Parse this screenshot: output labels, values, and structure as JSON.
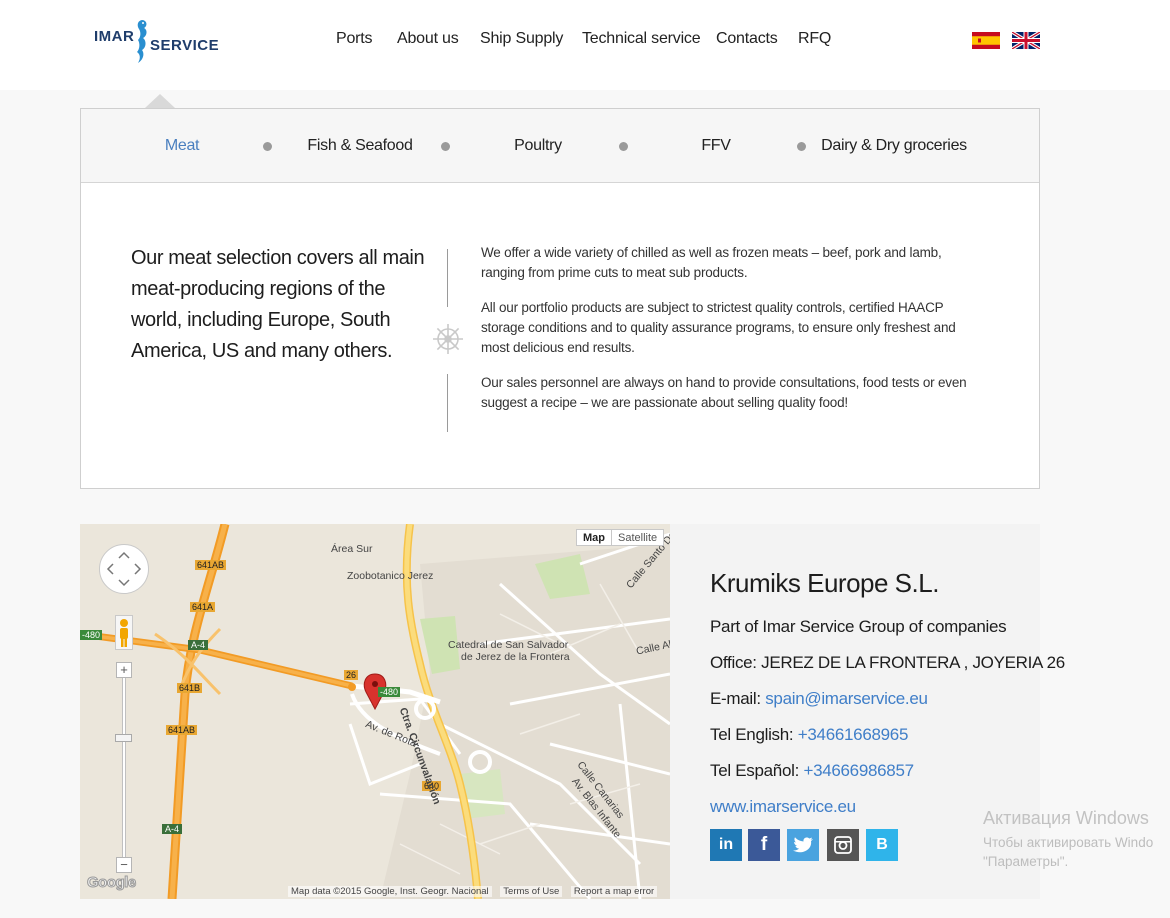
{
  "header": {
    "logo_left": "IMAR",
    "logo_right": "SERVICE",
    "nav": [
      {
        "label": "Ports"
      },
      {
        "label": "About us"
      },
      {
        "label": "Ship Supply"
      },
      {
        "label": "Technical service"
      },
      {
        "label": "Contacts"
      },
      {
        "label": "RFQ"
      }
    ]
  },
  "categories": {
    "tabs": [
      {
        "label": "Meat",
        "active": true
      },
      {
        "label": "Fish & Seafood",
        "active": false
      },
      {
        "label": "Poultry",
        "active": false
      },
      {
        "label": "FFV",
        "active": false
      },
      {
        "label": "Dairy & Dry groceries",
        "active": false
      }
    ],
    "lead": "Our meat selection covers all main meat-producing regions of the world, including Europe, South America, US and many others.",
    "paragraphs": [
      "We offer a wide variety of chilled as well as frozen meats – beef, pork and lamb, ranging from prime cuts to meat sub products.",
      "All our portfolio products are subject to strictest quality controls, certified HAACP storage conditions and to quality assurance programs, to ensure only freshest and most delicious end results.",
      "Our sales personnel are always on hand to provide consultations, food tests or even suggest a recipe – we are passionate about selling quality food!"
    ]
  },
  "map": {
    "type_buttons": [
      "Map",
      "Satellite"
    ],
    "zoom_plus": "+",
    "zoom_minus": "−",
    "labels": {
      "area_sur": "Área Sur",
      "zoo": "Zoobotanico Jerez",
      "catedral1": "Catedral de San Salvador",
      "catedral2": "de Jerez de la Frontera",
      "calle_santo": "Calle Santo Do",
      "calle_al": "Calle Al",
      "ctra": "Ctra. Circunvalación",
      "av_rota": "Av. de Rota",
      "calle_canarias": "Calle Canarias",
      "av_blas": "Av. Blas Infante",
      "r641ab_top": "641AB",
      "r641a": "641A",
      "r641b": "641B",
      "r641ab_bot": "641AB",
      "a4_top": "A-4",
      "a4_bot": "A-4",
      "r480_left": "-480",
      "r480_right": "-480",
      "r26": "26",
      "r640": "640"
    },
    "google": "Google",
    "attribution": {
      "data": "Map data ©2015 Google, Inst. Geogr. Nacional",
      "terms": "Terms of Use",
      "report": "Report a map error"
    }
  },
  "contact": {
    "company": "Krumiks Europe S.L.",
    "group": "Part of Imar Service Group of companies",
    "office": "Office: JEREZ DE LA FRONTERA , JOYERIA 26",
    "email_label": "E-mail: ",
    "email": "spain@imarservice.eu",
    "tel_en_label": "Tel English: ",
    "tel_en": "+34661668965",
    "tel_es_label": "Tel Español: ",
    "tel_es": "+34666986857",
    "website": "www.imarservice.eu",
    "social": [
      {
        "name": "linkedin",
        "glyph": "in",
        "color": "#1f78b4"
      },
      {
        "name": "facebook",
        "glyph": "f",
        "color": "#3b5998"
      },
      {
        "name": "twitter",
        "glyph": "🐦",
        "color": "#4aa3df"
      },
      {
        "name": "instagram",
        "glyph": "◙",
        "color": "#555555"
      },
      {
        "name": "vk",
        "glyph": "B",
        "color": "#2fb4ea"
      }
    ]
  },
  "watermark": {
    "title": "Активация Windows",
    "line1": "Чтобы активировать Windo",
    "line2": "\"Параметры\"."
  }
}
